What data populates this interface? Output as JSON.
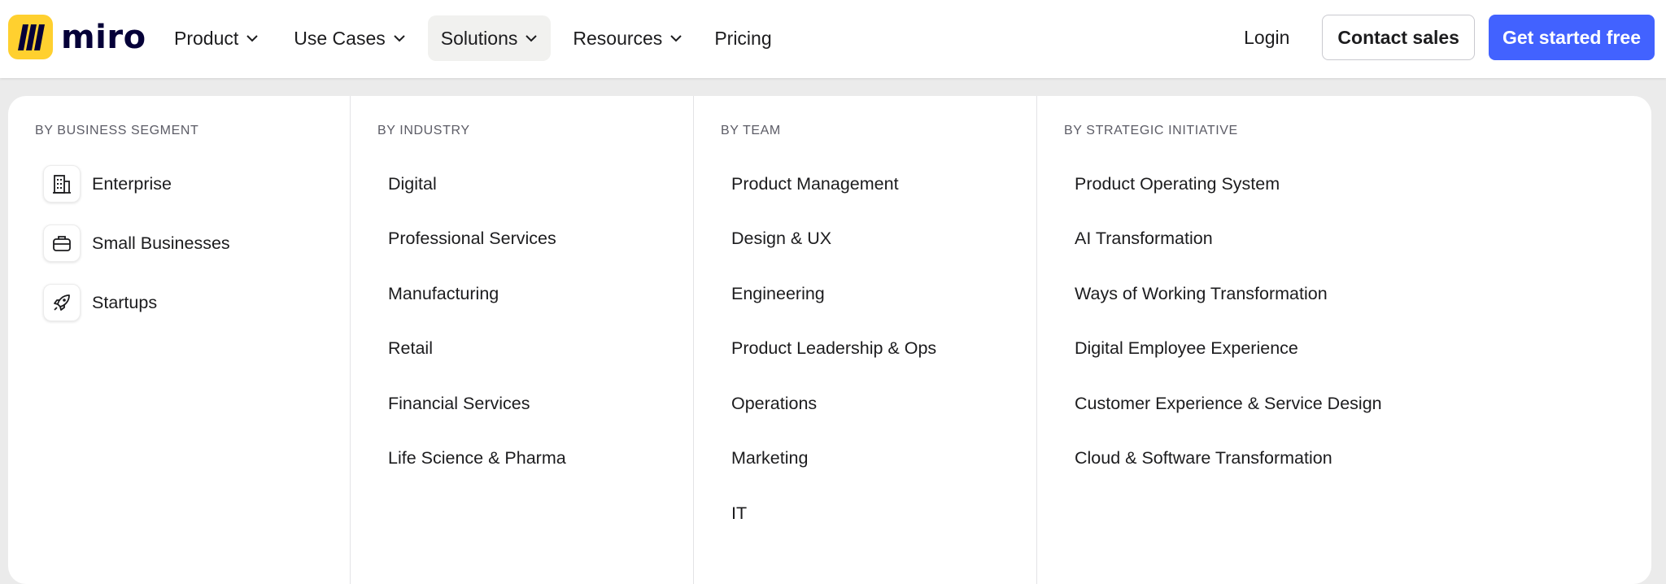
{
  "brand": {
    "name": "miro",
    "logo_color": "#ffd02f"
  },
  "nav": {
    "items": [
      {
        "label": "Product",
        "has_dropdown": true
      },
      {
        "label": "Use Cases",
        "has_dropdown": true
      },
      {
        "label": "Solutions",
        "has_dropdown": true,
        "active": true
      },
      {
        "label": "Resources",
        "has_dropdown": true
      },
      {
        "label": "Pricing",
        "has_dropdown": false
      }
    ]
  },
  "actions": {
    "login": "Login",
    "contact_sales": "Contact sales",
    "get_started": "Get started free",
    "primary_color": "#4262ff"
  },
  "menu": {
    "business_segment": {
      "title": "BY BUSINESS SEGMENT",
      "items": [
        {
          "label": "Enterprise",
          "icon": "building-icon"
        },
        {
          "label": "Small Businesses",
          "icon": "briefcase-icon"
        },
        {
          "label": "Startups",
          "icon": "rocket-icon"
        }
      ]
    },
    "industry": {
      "title": "BY INDUSTRY",
      "items": [
        "Digital",
        "Professional Services",
        "Manufacturing",
        "Retail",
        "Financial Services",
        "Life Science & Pharma"
      ]
    },
    "team": {
      "title": "BY TEAM",
      "items": [
        "Product Management",
        "Design & UX",
        "Engineering",
        "Product Leadership & Ops",
        "Operations",
        "Marketing",
        "IT"
      ]
    },
    "strategic": {
      "title": "BY STRATEGIC INITIATIVE",
      "items": [
        "Product Operating System",
        "AI Transformation",
        "Ways of Working Transformation",
        "Digital Employee Experience",
        "Customer Experience & Service Design",
        "Cloud & Software Transformation"
      ]
    }
  }
}
